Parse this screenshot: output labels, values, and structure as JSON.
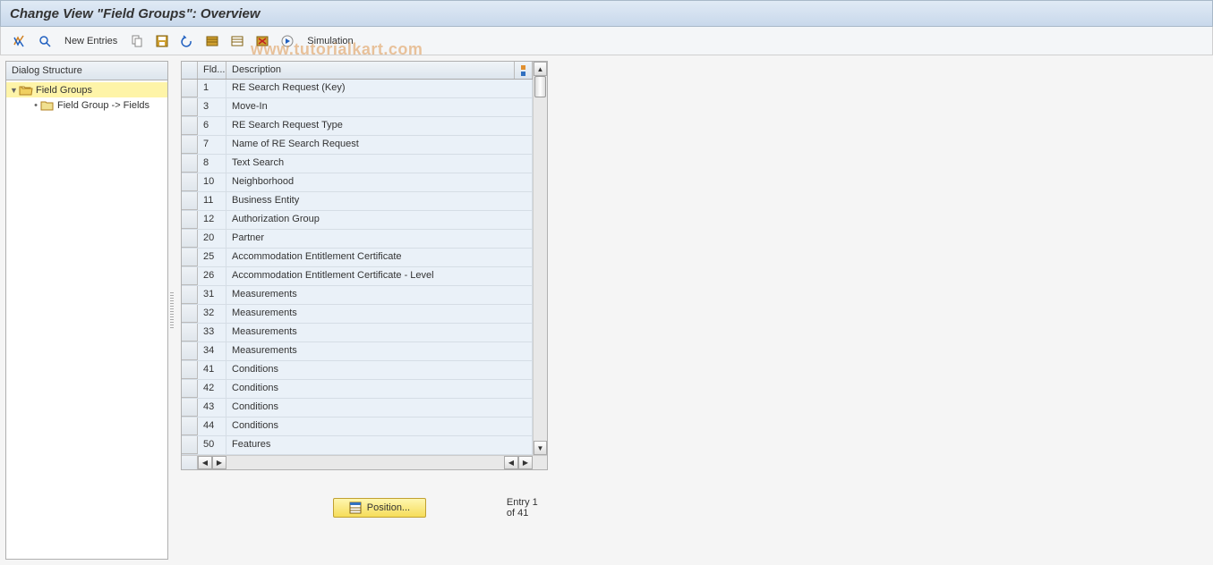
{
  "title": "Change View \"Field Groups\": Overview",
  "toolbar": {
    "new_entries": "New Entries",
    "simulation": "Simulation"
  },
  "tree": {
    "header": "Dialog Structure",
    "root": "Field Groups",
    "child": "Field Group -> Fields"
  },
  "grid": {
    "headers": {
      "fld": "Fld...",
      "desc": "Description"
    },
    "rows": [
      {
        "fld": "1",
        "desc": "RE Search Request (Key)"
      },
      {
        "fld": "3",
        "desc": "Move-In"
      },
      {
        "fld": "6",
        "desc": "RE Search Request Type"
      },
      {
        "fld": "7",
        "desc": "Name of RE Search Request"
      },
      {
        "fld": "8",
        "desc": "Text Search"
      },
      {
        "fld": "10",
        "desc": "Neighborhood"
      },
      {
        "fld": "11",
        "desc": "Business Entity"
      },
      {
        "fld": "12",
        "desc": "Authorization Group"
      },
      {
        "fld": "20",
        "desc": "Partner"
      },
      {
        "fld": "25",
        "desc": "Accommodation Entitlement Certificate"
      },
      {
        "fld": "26",
        "desc": "Accommodation Entitlement Certificate - Level"
      },
      {
        "fld": "31",
        "desc": "Measurements"
      },
      {
        "fld": "32",
        "desc": "Measurements"
      },
      {
        "fld": "33",
        "desc": "Measurements"
      },
      {
        "fld": "34",
        "desc": "Measurements"
      },
      {
        "fld": "41",
        "desc": "Conditions"
      },
      {
        "fld": "42",
        "desc": "Conditions"
      },
      {
        "fld": "43",
        "desc": "Conditions"
      },
      {
        "fld": "44",
        "desc": "Conditions"
      },
      {
        "fld": "50",
        "desc": "Features"
      }
    ]
  },
  "footer": {
    "position": "Position...",
    "entry": "Entry 1 of 41"
  },
  "watermark": "www.tutorialkart.com"
}
